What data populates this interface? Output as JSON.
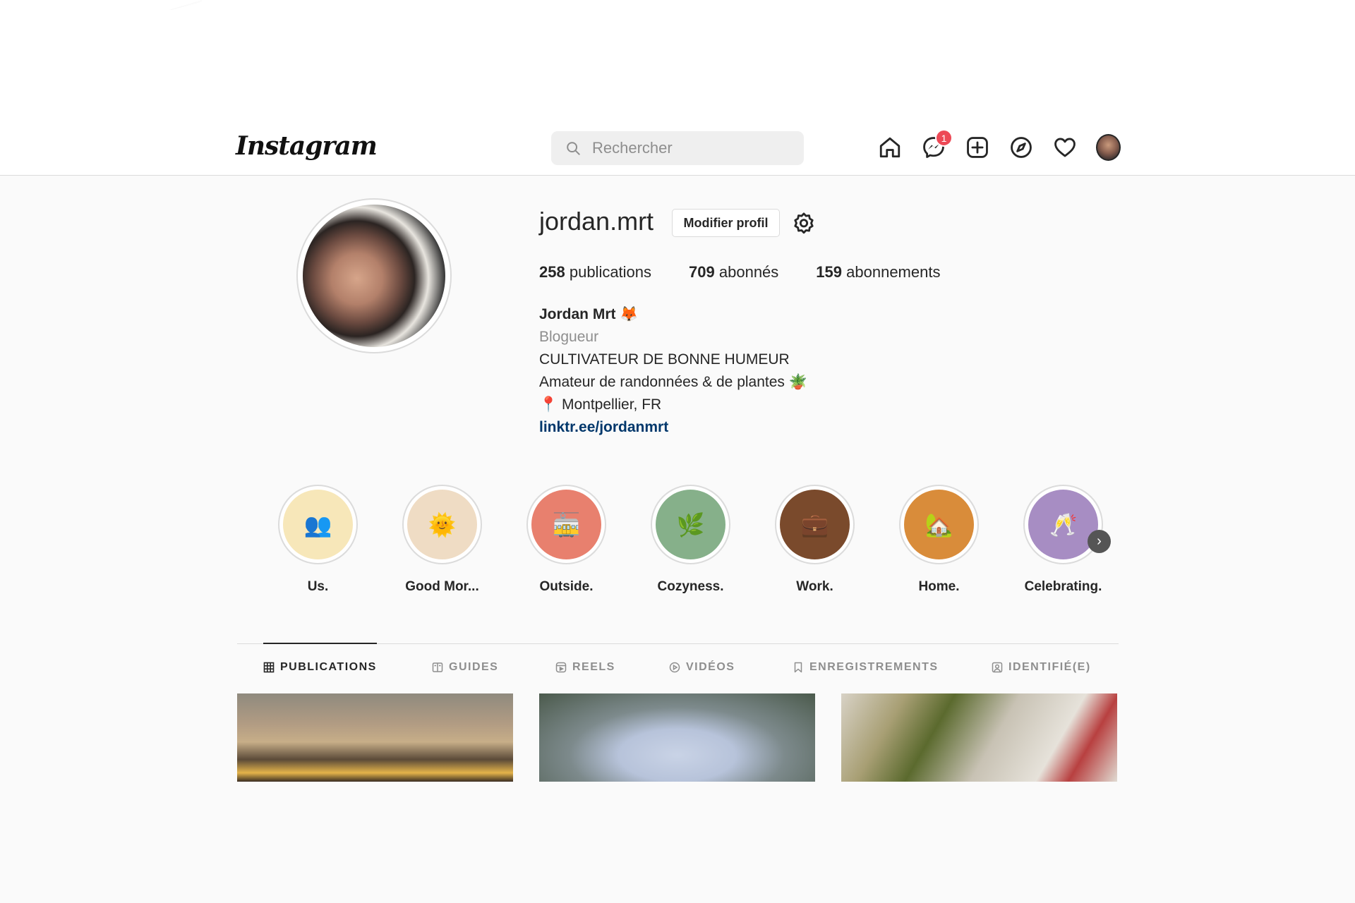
{
  "header": {
    "logo": "Instagram",
    "search_placeholder": "Rechercher",
    "messenger_badge": "1"
  },
  "profile": {
    "username": "jordan.mrt",
    "edit_button": "Modifier profil",
    "stats": {
      "posts_count": "258",
      "posts_label": "publications",
      "followers_count": "709",
      "followers_label": "abonnés",
      "following_count": "159",
      "following_label": "abonnements"
    },
    "bio": {
      "name": "Jordan Mrt 🦊",
      "category": "Blogueur",
      "line1": "CULTIVATEUR DE BONNE HUMEUR",
      "line2": "Amateur de randonnées & de plantes 🪴",
      "line3": "📍 Montpellier, FR",
      "link": "linktr.ee/jordanmrt"
    }
  },
  "highlights": [
    {
      "label": "Us.",
      "emoji": "👥",
      "color": "#f7e7b9"
    },
    {
      "label": "Good Mor...",
      "emoji": "🌞",
      "color": "#efdcc4"
    },
    {
      "label": "Outside.",
      "emoji": "🚋",
      "color": "#e8806e"
    },
    {
      "label": "Cozyness.",
      "emoji": "🌿",
      "color": "#86b08a"
    },
    {
      "label": "Work.",
      "emoji": "💼",
      "color": "#7a4a2c"
    },
    {
      "label": "Home.",
      "emoji": "🏡",
      "color": "#d98c3a"
    },
    {
      "label": "Celebrating.",
      "emoji": "🥂",
      "color": "#a78dc3"
    }
  ],
  "tabs": [
    {
      "label": "PUBLICATIONS",
      "icon": "grid-icon",
      "active": true
    },
    {
      "label": "GUIDES",
      "icon": "guide-icon",
      "active": false
    },
    {
      "label": "REELS",
      "icon": "reels-icon",
      "active": false
    },
    {
      "label": "VIDÉOS",
      "icon": "play-icon",
      "active": false
    },
    {
      "label": "ENREGISTREMENTS",
      "icon": "bookmark-icon",
      "active": false
    },
    {
      "label": "IDENTIFIÉ(E)",
      "icon": "tagged-icon",
      "active": false
    }
  ]
}
